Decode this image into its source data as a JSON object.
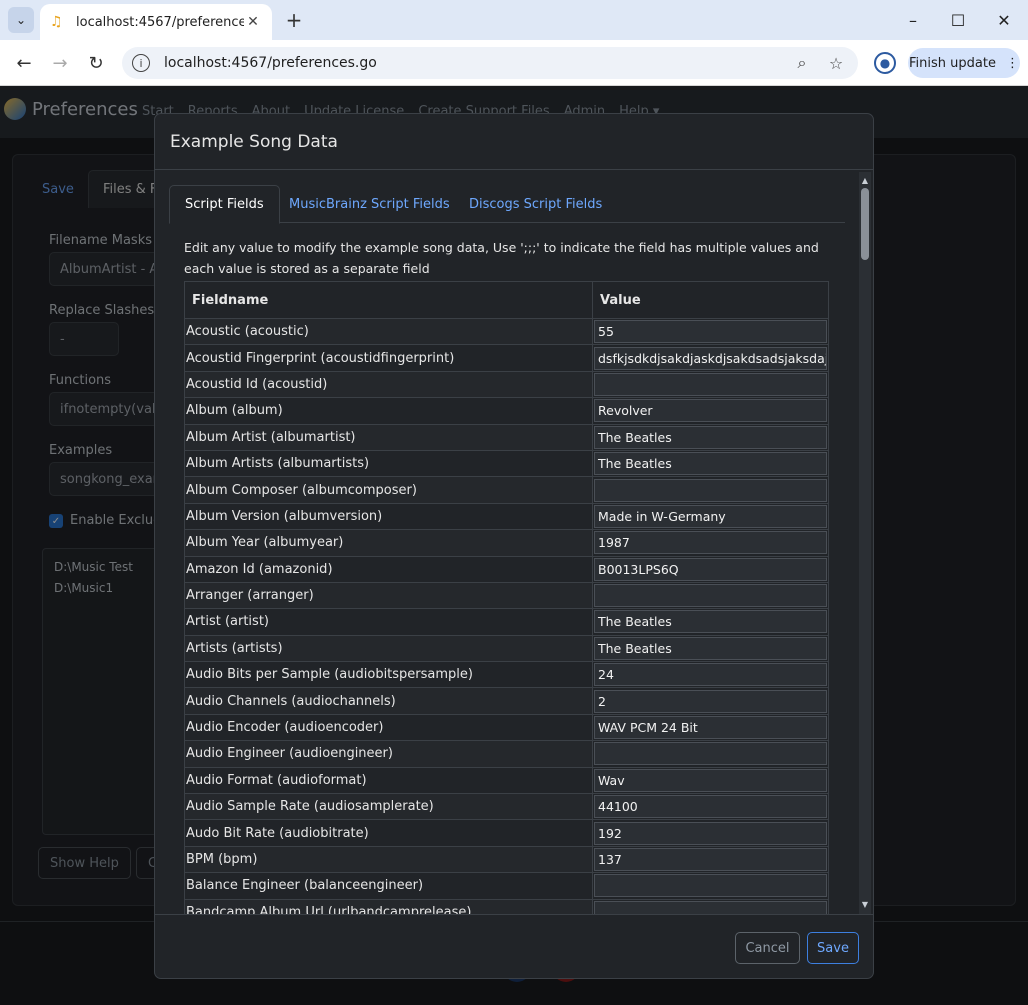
{
  "browser": {
    "tab_title": "localhost:4567/preferences.go",
    "url": "localhost:4567/preferences.go",
    "finish_update": "Finish update"
  },
  "app": {
    "brand": "Preferences",
    "nav": [
      "Start",
      "Reports",
      "About",
      "Update License",
      "Create Support Files",
      "Admin",
      "Help ▾"
    ],
    "tabs": [
      "Save",
      "Files & Fo"
    ],
    "fields": [
      {
        "label": "Filename Masks",
        "value": "AlbumArtist - Al"
      },
      {
        "label": "Replace Slashes W",
        "value": "-"
      },
      {
        "label": "Functions",
        "value": "ifnotempty(valu"
      },
      {
        "label": "Examples",
        "value": "songkong_exam"
      }
    ],
    "checkbox_label": "Enable Exclude",
    "folders": [
      "D:\\Music Test",
      "D:\\Music1"
    ],
    "buttons": [
      "Show Help",
      "C"
    ]
  },
  "modal": {
    "title": "Example Song Data",
    "tabs": [
      "Script Fields",
      "MusicBrainz Script Fields",
      "Discogs Script Fields"
    ],
    "description": "Edit any value to modify the example song data, Use ';;;' to indicate the field has multiple values and each value is stored as a separate field",
    "columns": [
      "Fieldname",
      "Value"
    ],
    "rows": [
      {
        "field": "Acoustic (acoustic)",
        "value": "55"
      },
      {
        "field": "Acoustid Fingerprint (acoustidfingerprint)",
        "value": "dsfkjsdkdjsakdjaskdjsakdsadsjaksdajdsakdj"
      },
      {
        "field": "Acoustid Id (acoustid)",
        "value": ""
      },
      {
        "field": "Album (album)",
        "value": "Revolver"
      },
      {
        "field": "Album Artist (albumartist)",
        "value": "The Beatles"
      },
      {
        "field": "Album Artists (albumartists)",
        "value": "The Beatles"
      },
      {
        "field": "Album Composer (albumcomposer)",
        "value": ""
      },
      {
        "field": "Album Version (albumversion)",
        "value": "Made in W-Germany"
      },
      {
        "field": "Album Year (albumyear)",
        "value": "1987"
      },
      {
        "field": "Amazon Id (amazonid)",
        "value": "B0013LPS6Q"
      },
      {
        "field": "Arranger (arranger)",
        "value": ""
      },
      {
        "field": "Artist (artist)",
        "value": "The Beatles"
      },
      {
        "field": "Artists (artists)",
        "value": "The Beatles"
      },
      {
        "field": "Audio Bits per Sample (audiobitspersample)",
        "value": "24"
      },
      {
        "field": "Audio Channels (audiochannels)",
        "value": "2"
      },
      {
        "field": "Audio Encoder (audioencoder)",
        "value": "WAV PCM 24 Bit"
      },
      {
        "field": "Audio Engineer (audioengineer)",
        "value": ""
      },
      {
        "field": "Audio Format (audioformat)",
        "value": "Wav"
      },
      {
        "field": "Audio Sample Rate (audiosamplerate)",
        "value": "44100"
      },
      {
        "field": "Audo Bit Rate (audiobitrate)",
        "value": "192"
      },
      {
        "field": "BPM (bpm)",
        "value": "137"
      },
      {
        "field": "Balance Engineer (balanceengineer)",
        "value": ""
      },
      {
        "field": "Bandcamp Album Url (urlbandcamprelease)",
        "value": ""
      }
    ],
    "cancel": "Cancel",
    "save": "Save"
  }
}
